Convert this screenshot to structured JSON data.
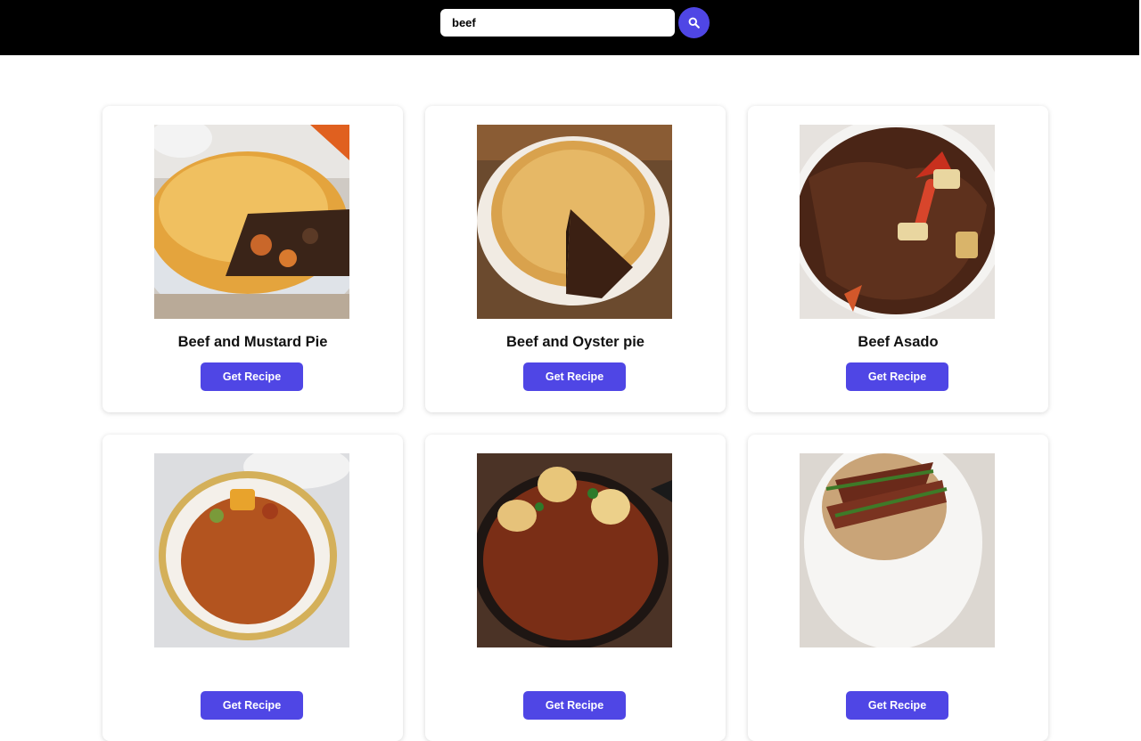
{
  "search": {
    "value": "beef",
    "icon": "search-icon"
  },
  "results": [
    {
      "title": "Beef and Mustard Pie",
      "button": "Get Recipe"
    },
    {
      "title": "Beef and Oyster pie",
      "button": "Get Recipe"
    },
    {
      "title": "Beef Asado",
      "button": "Get Recipe"
    },
    {
      "title": "",
      "button": "Get Recipe"
    },
    {
      "title": "",
      "button": "Get Recipe"
    },
    {
      "title": "",
      "button": "Get Recipe"
    }
  ],
  "colors": {
    "header_bg": "#000000",
    "accent": "#4f46e5"
  }
}
